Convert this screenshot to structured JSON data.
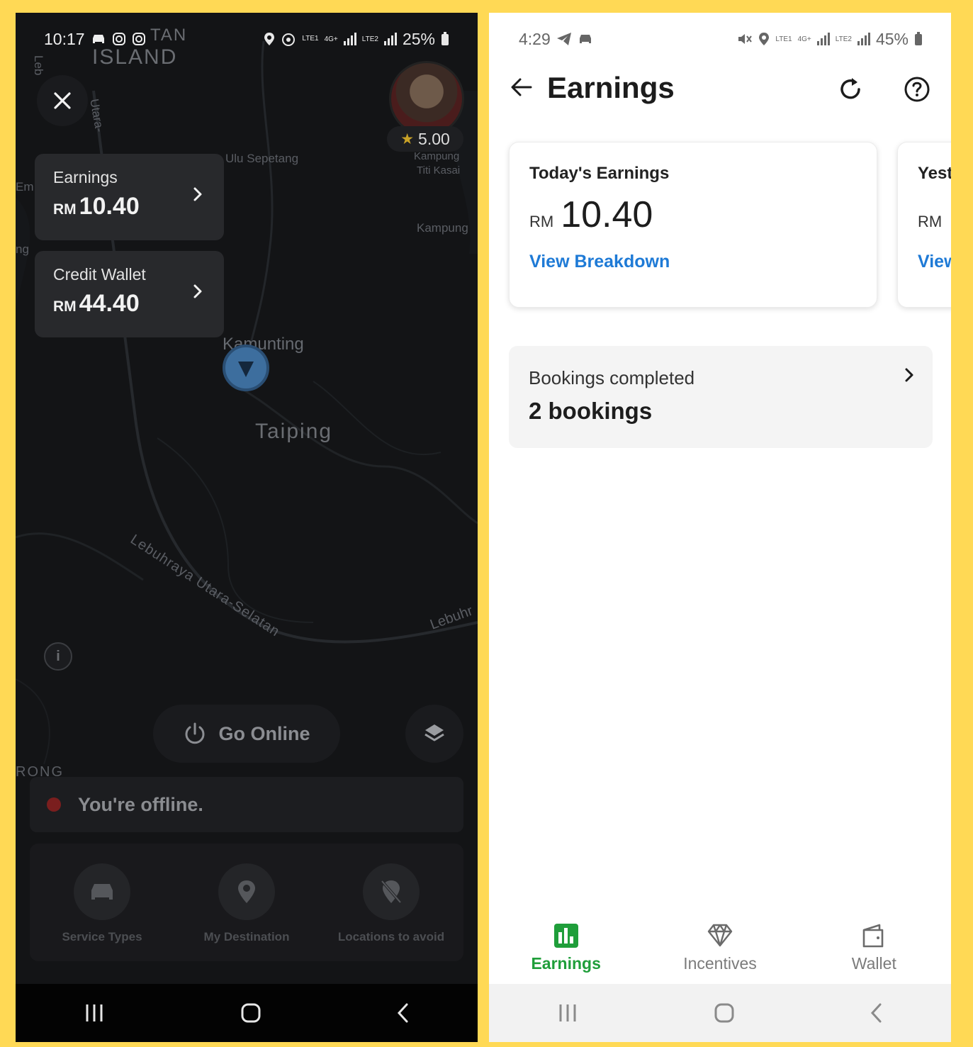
{
  "left_phone": {
    "status": {
      "time": "10:17",
      "battery": "25%",
      "lte1": "LTE1",
      "lte2": "LTE2",
      "net": "4G+"
    },
    "map_labels": {
      "island": "ISLAND",
      "tan": "TAN",
      "ulu_sepetang": "Ulu Sepetang",
      "kampung_titi": "Kampung",
      "kampung_titi2": "Titi Kasai",
      "kampung": "Kampung",
      "kamunting": "Kamunting",
      "taiping": "Taiping",
      "highway": "Lebuhraya Utara-Selatan",
      "lebuh": "Lebuhr",
      "utara": "Utara-",
      "rong": "RONG",
      "leb": "Leb",
      "em": "Em",
      "ng": "ng"
    },
    "rating": "5.00",
    "earnings_card": {
      "label": "Earnings",
      "currency": "RM",
      "amount": "10.40"
    },
    "wallet_card": {
      "label": "Credit Wallet",
      "currency": "RM",
      "amount": "44.40"
    },
    "go_online": "Go Online",
    "offline_message": "You're offline.",
    "quick_actions": [
      {
        "label": "Service Types",
        "icon": "car-icon"
      },
      {
        "label": "My Destination",
        "icon": "pin-icon"
      },
      {
        "label": "Locations to avoid",
        "icon": "no-pin-icon"
      }
    ]
  },
  "right_phone": {
    "status": {
      "time": "4:29",
      "battery": "45%",
      "lte1": "LTE1",
      "lte2": "LTE2",
      "net": "4G+"
    },
    "title": "Earnings",
    "cards": [
      {
        "heading": "Today's Earnings",
        "currency": "RM",
        "amount": "10.40",
        "link": "View Breakdown"
      },
      {
        "heading": "Yest",
        "currency": "RM",
        "amount": "(",
        "link": "View"
      }
    ],
    "bookings": {
      "label": "Bookings completed",
      "value": "2 bookings"
    },
    "tabs": [
      {
        "label": "Earnings",
        "active": true
      },
      {
        "label": "Incentives",
        "active": false
      },
      {
        "label": "Wallet",
        "active": false
      }
    ]
  },
  "colors": {
    "frame": "#ffd955",
    "accent_green": "#1f9e3a",
    "link_blue": "#1e7ad6",
    "location_blue": "#3d6e9e"
  }
}
